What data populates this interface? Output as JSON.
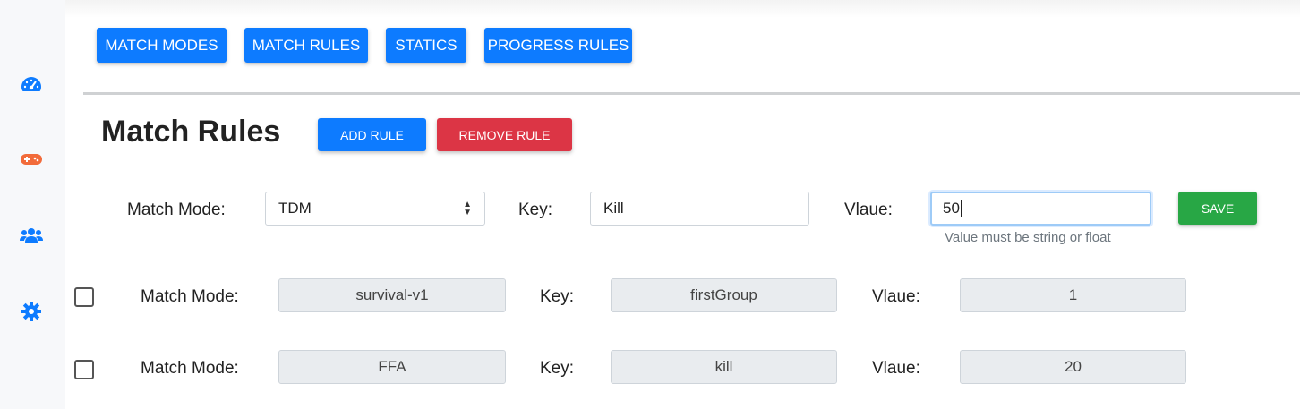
{
  "sidebar": {
    "icons": [
      "dashboard-icon",
      "gamepad-icon",
      "users-icon",
      "gear-icon"
    ],
    "colors": {
      "primary": "#0d7bff",
      "game": "#f26b3a"
    }
  },
  "nav": {
    "tabs": [
      {
        "label": "MATCH MODES"
      },
      {
        "label": "MATCH RULES"
      },
      {
        "label": "STATICS"
      },
      {
        "label": "PROGRESS RULES"
      }
    ]
  },
  "page": {
    "title": "Match Rules",
    "add_rule_label": "ADD RULE",
    "remove_rule_label": "REMOVE RULE"
  },
  "form": {
    "match_mode_label": "Match Mode:",
    "match_mode_value": "TDM",
    "key_label": "Key:",
    "key_value": "Kill",
    "value_label": "Vlaue:",
    "value_value": "50",
    "value_hint": "Value must be string or float",
    "save_label": "SAVE"
  },
  "rules": [
    {
      "match_mode_label": "Match Mode:",
      "match_mode": "survival-v1",
      "key_label": "Key:",
      "key": "firstGroup",
      "value_label": "Vlaue:",
      "value": "1",
      "checked": false
    },
    {
      "match_mode_label": "Match Mode:",
      "match_mode": "FFA",
      "key_label": "Key:",
      "key": "kill",
      "value_label": "Vlaue:",
      "value": "20",
      "checked": false
    }
  ],
  "colors": {
    "blue": "#0d7bff",
    "red": "#dc3545",
    "green": "#28a745",
    "readonly_bg": "#e9ecef"
  }
}
